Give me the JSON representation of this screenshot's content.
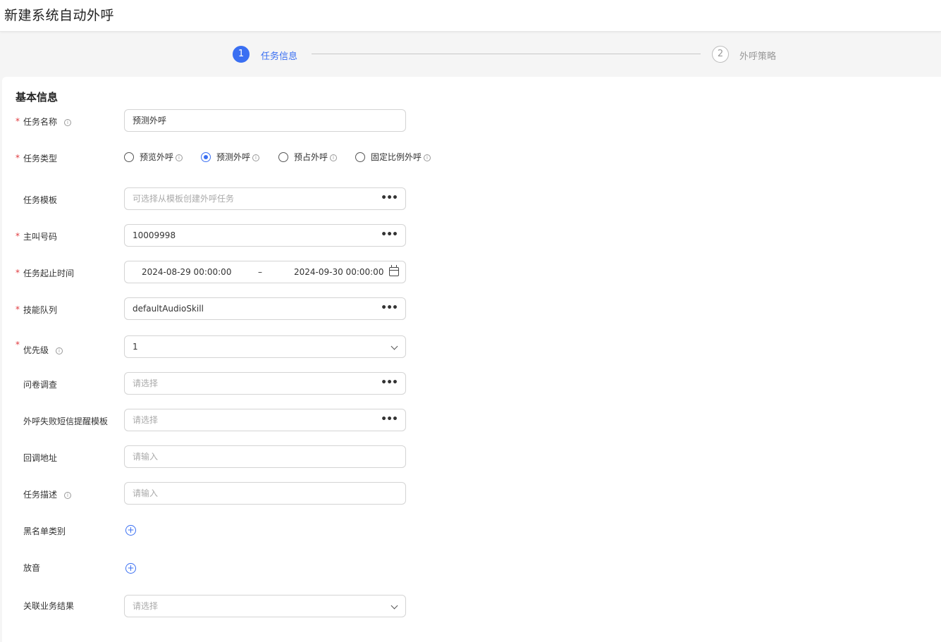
{
  "page_title": "新建系统自动外呼",
  "steps": [
    {
      "number": "1",
      "label": "任务信息"
    },
    {
      "number": "2",
      "label": "外呼策略"
    }
  ],
  "section_title": "基本信息",
  "form": {
    "task_name": {
      "label": "任务名称",
      "value": "预测外呼"
    },
    "task_type": {
      "label": "任务类型",
      "options": [
        "预览外呼",
        "预测外呼",
        "预占外呼",
        "固定比例外呼"
      ],
      "selected": "预测外呼"
    },
    "task_template": {
      "label": "任务模板",
      "placeholder": "可选择从模板创建外呼任务"
    },
    "caller_number": {
      "label": "主叫号码",
      "value": "10009998"
    },
    "task_time": {
      "label": "任务起止时间",
      "start": "2024-08-29 00:00:00",
      "separator": "–",
      "end": "2024-09-30 00:00:00"
    },
    "skill_queue": {
      "label": "技能队列",
      "value": "defaultAudioSkill"
    },
    "priority": {
      "label": "优先级",
      "value": "1"
    },
    "questionnaire": {
      "label": "问卷调查",
      "placeholder": "请选择"
    },
    "sms_template": {
      "label": "外呼失败短信提醒模板",
      "placeholder": "请选择"
    },
    "callback_url": {
      "label": "回调地址",
      "placeholder": "请输入"
    },
    "task_desc": {
      "label": "任务描述",
      "placeholder": "请输入"
    },
    "blacklist": {
      "label": "黑名单类别"
    },
    "playback": {
      "label": "放音"
    },
    "business_result": {
      "label": "关联业务结果",
      "placeholder": "请选择"
    }
  },
  "colors": {
    "primary": "#3a6ff2",
    "required": "#e0393e"
  }
}
